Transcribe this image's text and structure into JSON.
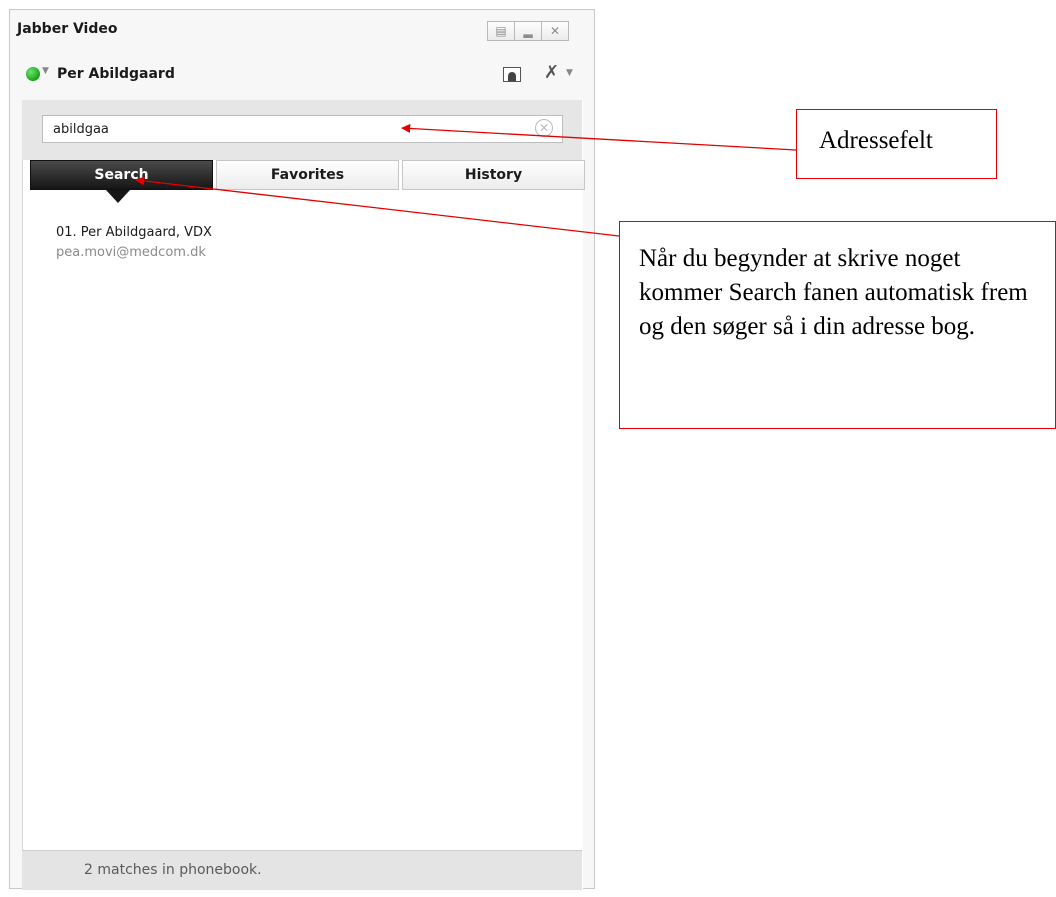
{
  "window": {
    "title": "Jabber Video",
    "buttons": [
      "pin",
      "minimize",
      "close"
    ]
  },
  "user": {
    "name": "Per Abildgaard",
    "status_color": "#16a316"
  },
  "search": {
    "value": "abildgaa"
  },
  "tabs": [
    {
      "label": "Search",
      "active": true
    },
    {
      "label": "Favorites",
      "active": false
    },
    {
      "label": "History",
      "active": false
    }
  ],
  "results": [
    {
      "name": "01. Per Abildgaard, VDX",
      "email": "pea.movi@medcom.dk"
    }
  ],
  "footer": {
    "text": "2 matches in phonebook."
  },
  "annotations": {
    "address_field": "Adressefelt",
    "search_tab": "Når du begynder at skrive noget kommer Search fanen automatisk frem og den søger så i din adresse bog.",
    "color": "#e30000"
  }
}
